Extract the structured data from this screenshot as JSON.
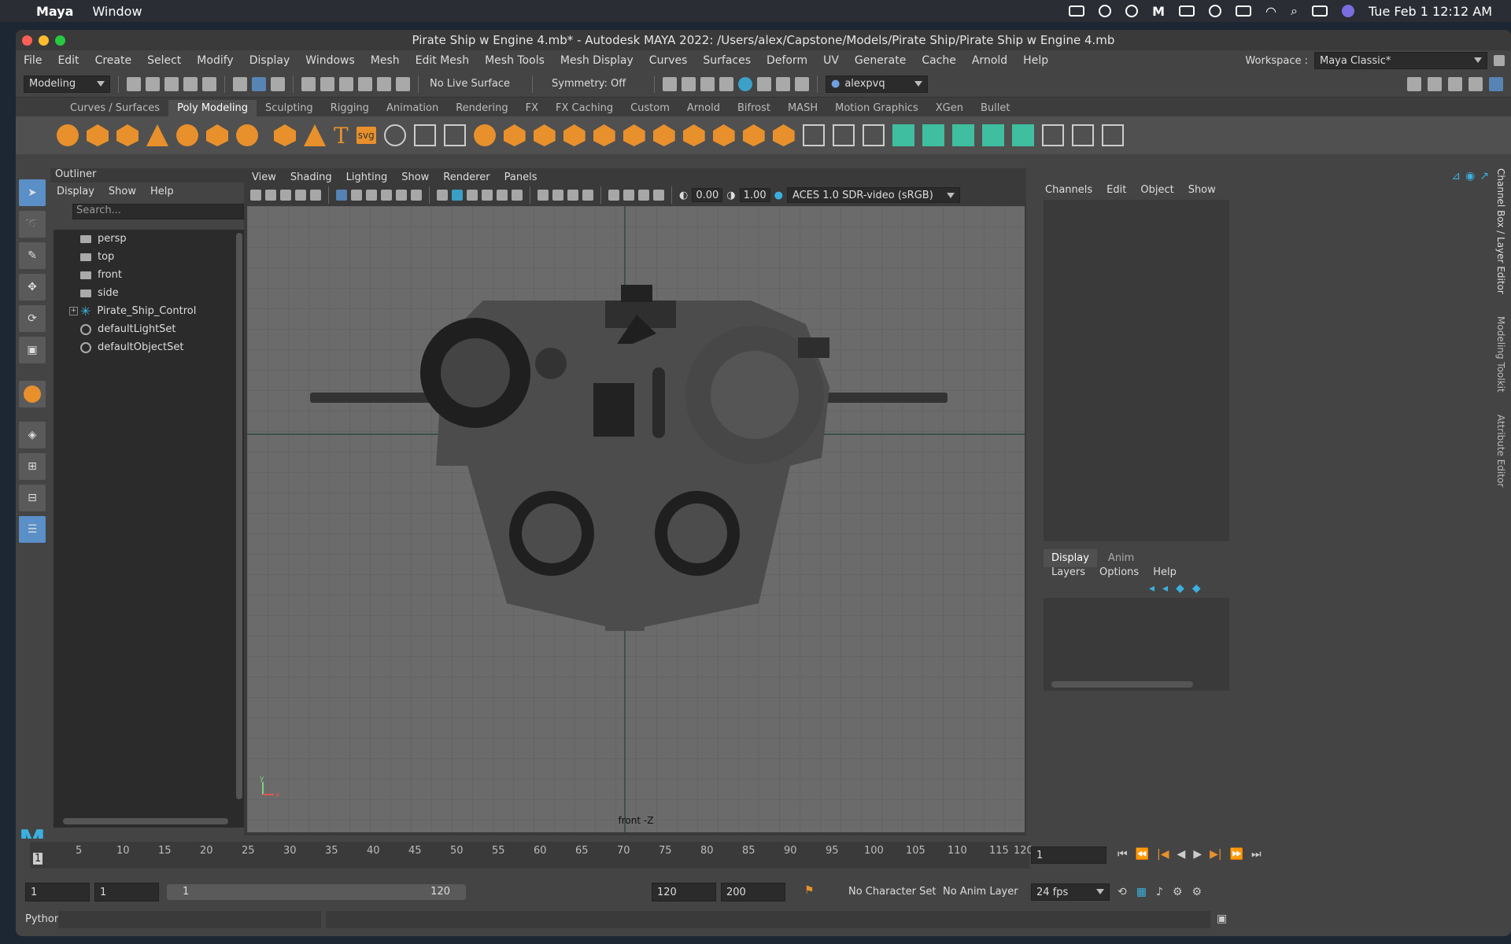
{
  "mac": {
    "app": "Maya",
    "window_menu": "Window",
    "clock": "Tue Feb 1  12:12 AM"
  },
  "window": {
    "title": "Pirate Ship w Engine 4.mb* - Autodesk MAYA 2022: /Users/alex/Capstone/Models/Pirate Ship/Pirate Ship w Engine 4.mb"
  },
  "menu": {
    "items": [
      "File",
      "Edit",
      "Create",
      "Select",
      "Modify",
      "Display",
      "Windows",
      "Mesh",
      "Edit Mesh",
      "Mesh Tools",
      "Mesh Display",
      "Curves",
      "Surfaces",
      "Deform",
      "UV",
      "Generate",
      "Cache",
      "Arnold",
      "Help"
    ],
    "workspace_label": "Workspace :",
    "workspace_value": "Maya Classic*"
  },
  "status": {
    "mode": "Modeling",
    "live_surface": "No Live Surface",
    "symmetry": "Symmetry: Off",
    "user": "alexpvq"
  },
  "shelf": {
    "tabs": [
      "Curves / Surfaces",
      "Poly Modeling",
      "Sculpting",
      "Rigging",
      "Animation",
      "Rendering",
      "FX",
      "FX Caching",
      "Custom",
      "Arnold",
      "Bifrost",
      "MASH",
      "Motion Graphics",
      "XGen",
      "Bullet"
    ],
    "active": "Poly Modeling",
    "text_tool": "T",
    "svg_tool": "svg"
  },
  "outliner": {
    "title": "Outliner",
    "menu": [
      "Display",
      "Show",
      "Help"
    ],
    "search_placeholder": "Search...",
    "items": [
      "persp",
      "top",
      "front",
      "side",
      "Pirate_Ship_Control",
      "defaultLightSet",
      "defaultObjectSet"
    ]
  },
  "viewport": {
    "menu": [
      "View",
      "Shading",
      "Lighting",
      "Show",
      "Renderer",
      "Panels"
    ],
    "exposure": "0.00",
    "gamma": "1.00",
    "color_space": "ACES 1.0 SDR-video (sRGB)",
    "camera_label": "front -Z",
    "axis_y": "y",
    "axis_x": "x"
  },
  "channel_box": {
    "menu": [
      "Channels",
      "Edit",
      "Object",
      "Show"
    ],
    "layer_tabs": [
      "Display",
      "Anim"
    ],
    "layer_menu": [
      "Layers",
      "Options",
      "Help"
    ],
    "side_tabs": [
      "Channel Box / Layer Editor",
      "Modeling Toolkit",
      "Attribute Editor"
    ]
  },
  "timeline": {
    "ticks": [
      "5",
      "10",
      "15",
      "20",
      "25",
      "30",
      "35",
      "40",
      "45",
      "50",
      "55",
      "60",
      "65",
      "70",
      "75",
      "80",
      "85",
      "90",
      "95",
      "100",
      "105",
      "110",
      "115",
      "120"
    ],
    "start_marker": "1",
    "current_frame": "1"
  },
  "range": {
    "start": "1",
    "playback_start": "1",
    "slider_start": "1",
    "slider_end": "120",
    "playback_end": "120",
    "end": "200",
    "character_set": "No Character Set",
    "anim_layer": "No Anim Layer",
    "fps": "24 fps"
  },
  "cmd": {
    "label": "Python"
  }
}
